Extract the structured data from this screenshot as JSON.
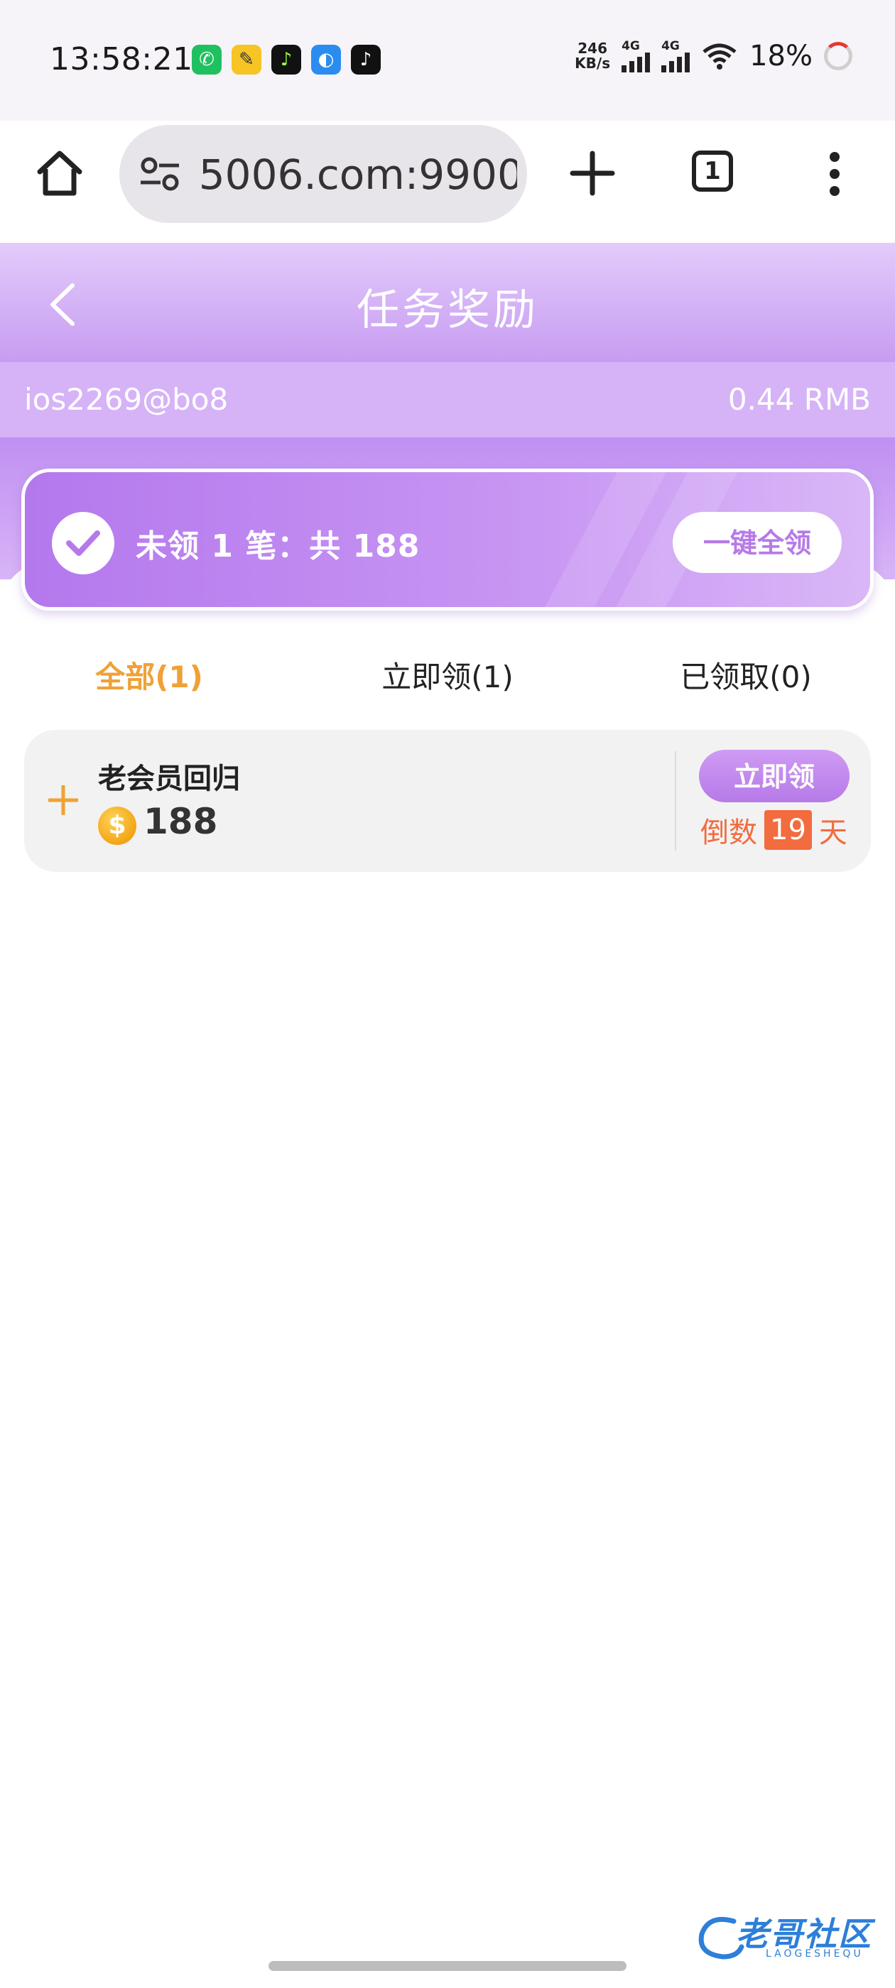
{
  "status_bar": {
    "time": "13:58:21",
    "net_speed_value": "246",
    "net_speed_unit": "KB/s",
    "signal1": "4G",
    "signal2": "4G",
    "battery": "18%"
  },
  "browser": {
    "url": " 5006.com:9900",
    "tab_count": "1"
  },
  "header": {
    "title": "任务奖励"
  },
  "account": {
    "username": "ios2269@bo8",
    "balance": "0.44 RMB"
  },
  "summary": {
    "text": "未领 1 笔：共 188",
    "claim_all_label": "一键全领"
  },
  "tabs": [
    {
      "label": "全部(1)",
      "active": true
    },
    {
      "label": "立即领(1)",
      "active": false
    },
    {
      "label": "已领取(0)",
      "active": false
    }
  ],
  "rewards": [
    {
      "name": "老会员回归",
      "amount": "188",
      "coin_symbol": "$",
      "claim_label": "立即领",
      "countdown_prefix": "倒数",
      "countdown_days": "19",
      "countdown_suffix": "天"
    }
  ],
  "watermark": {
    "text": "老哥社区",
    "sub": "LAOGESHEQU"
  },
  "colors": {
    "accent_purple": "#b67ae8",
    "tab_active": "#f0a136",
    "countdown": "#f26c3f"
  }
}
